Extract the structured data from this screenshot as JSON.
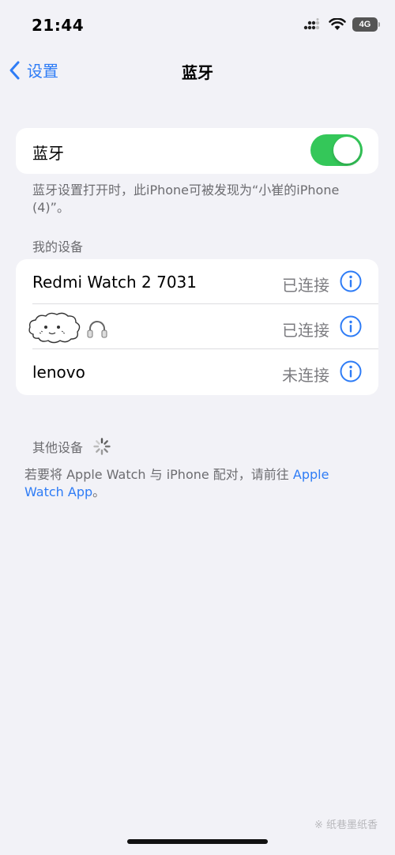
{
  "status_bar": {
    "time": "21:44",
    "network": "4G",
    "icons": [
      "signal-icon",
      "wifi-icon",
      "battery-icon"
    ]
  },
  "nav": {
    "back_label": "设置",
    "title": "蓝牙"
  },
  "bluetooth": {
    "label": "蓝牙",
    "enabled": true,
    "note": "蓝牙设置打开时，此iPhone可被发现为“小崔的iPhone (4)”。"
  },
  "my_devices": {
    "header": "我的设备",
    "items": [
      {
        "name": "Redmi Watch 2 7031",
        "status": "已连接",
        "icon": "info-icon"
      },
      {
        "name": "",
        "status": "已连接",
        "icon": "info-icon",
        "graphic": "cloud-doodle-headphones"
      },
      {
        "name": "lenovo",
        "status": "未连接",
        "icon": "info-icon"
      }
    ]
  },
  "other_devices": {
    "header": "其他设备",
    "icon": "spinner-icon"
  },
  "pair_note": {
    "text": "若要将 Apple Watch 与 iPhone 配对，请前往 ",
    "link": "Apple Watch App",
    "end": "。"
  },
  "watermark": "※ 纸巷墨纸香",
  "colors": {
    "accent": "#2e7cf6",
    "toggle_on": "#34c759",
    "background": "#f2f2f7",
    "secondary_text": "#6c6c70"
  }
}
